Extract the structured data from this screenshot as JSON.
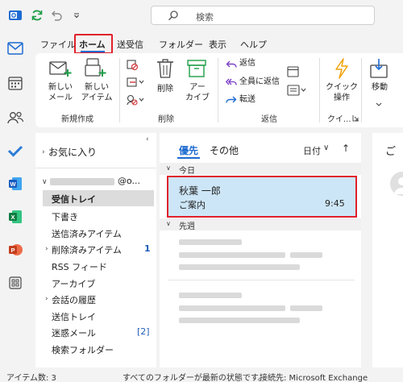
{
  "search": {
    "placeholder": "検索"
  },
  "menu": {
    "tabs": [
      "ファイル",
      "ホーム",
      "送受信",
      "フォルダー",
      "表示",
      "ヘルプ"
    ]
  },
  "ribbon": {
    "new_mail": "新しい\nメール",
    "new_item": "新しい\nアイテム",
    "group_new": "新規作成",
    "delete": "削除",
    "archive": "アー\nカイブ",
    "group_delete": "削除",
    "reply": "返信",
    "reply_all": "全員に返信",
    "forward": "転送",
    "group_reply": "返信",
    "quick_steps": "クイック\n操作",
    "group_quick": "クイ...",
    "move": "移動"
  },
  "folders": {
    "favorites": "お気に入り",
    "account_suffix": "@o...",
    "items": [
      {
        "label": "受信トレイ",
        "selected": true
      },
      {
        "label": "下書き"
      },
      {
        "label": "送信済みアイテム"
      },
      {
        "label": "削除済みアイテム",
        "count": "1",
        "expandable": true
      },
      {
        "label": "RSS フィード"
      },
      {
        "label": "アーカイブ"
      },
      {
        "label": "会話の履歴",
        "expandable": true
      },
      {
        "label": "送信トレイ"
      },
      {
        "label": "迷惑メール",
        "count": "[2]"
      },
      {
        "label": "検索フォルダー"
      }
    ]
  },
  "messages": {
    "tab_focused": "優先",
    "tab_other": "その他",
    "sort": "日付",
    "group_today": "今日",
    "group_lastweek": "先週",
    "selected": {
      "sender": "秋葉 一郎",
      "subject": "ご案内",
      "time": "9:45"
    }
  },
  "reading": {
    "title_partial": "ご"
  },
  "status": {
    "items": "アイテム数: 3",
    "sync": "すべてのフォルダーが最新の状態です。",
    "connection": "接続先: Microsoft Exchange"
  },
  "colors": {
    "accent": "#1f6bd1",
    "highlight_red": "#e0212b",
    "selected_row": "#cde6f7"
  }
}
